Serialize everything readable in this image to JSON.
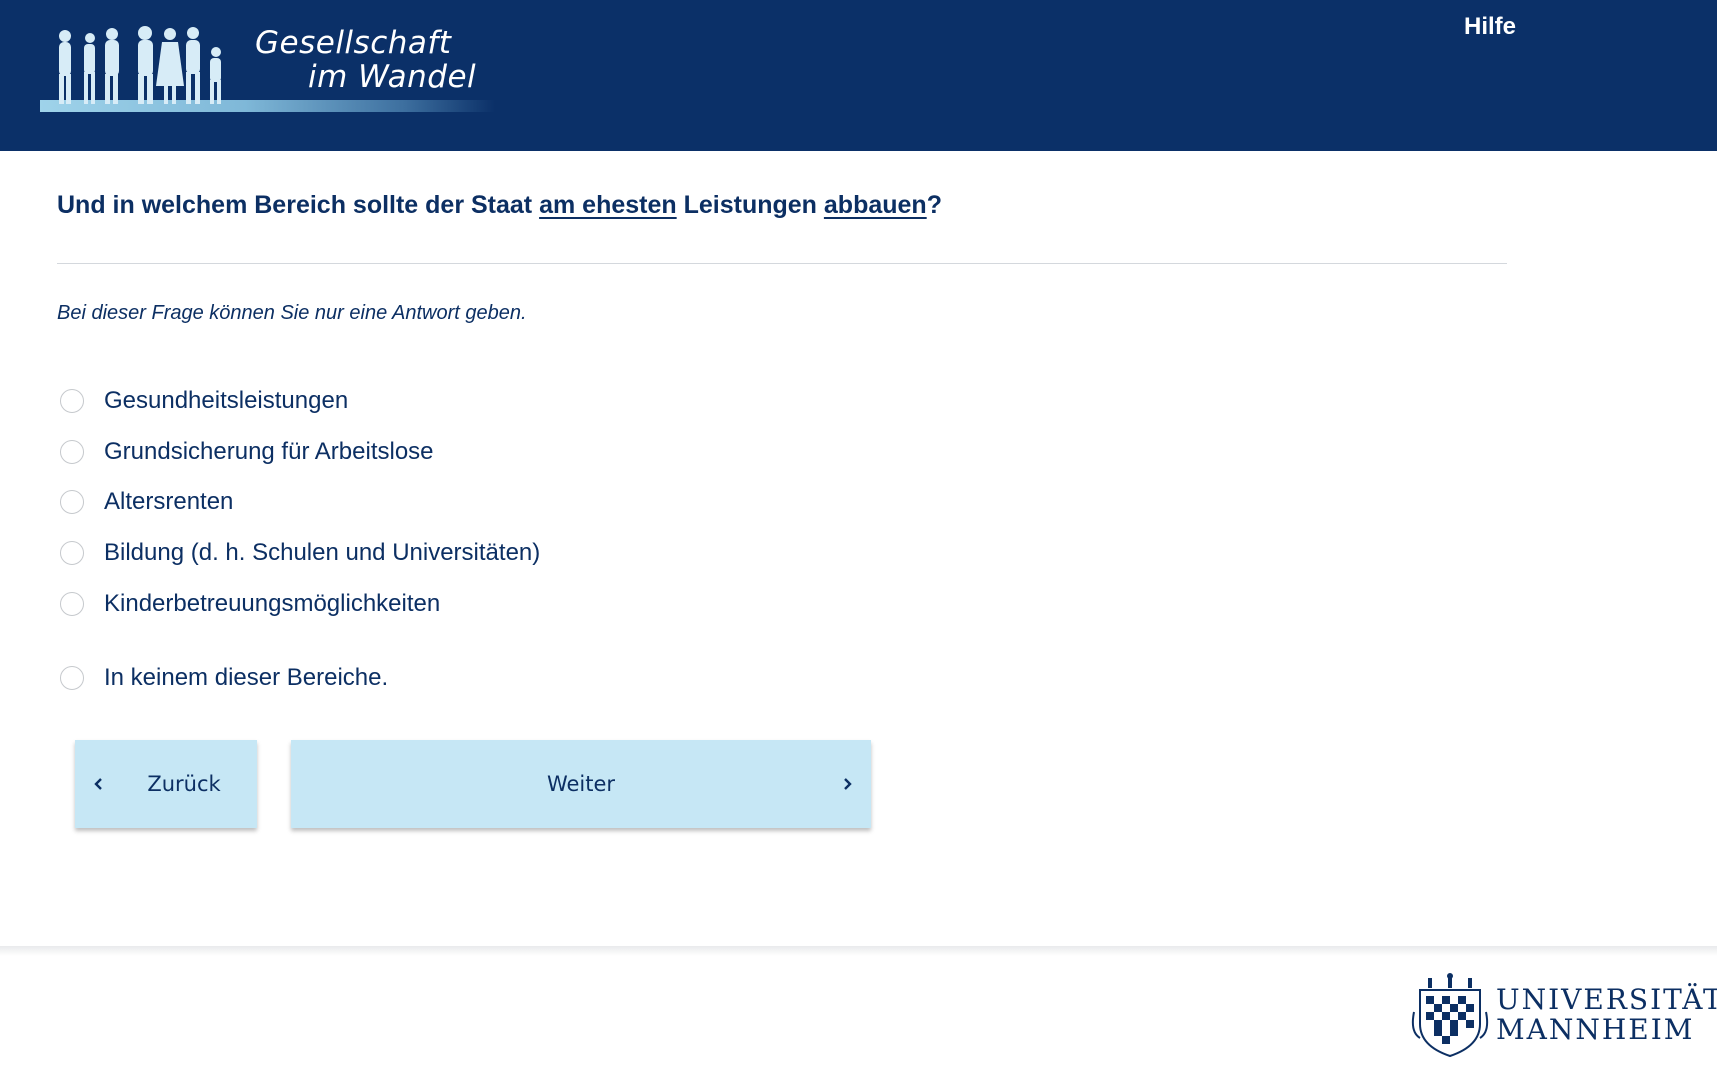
{
  "header": {
    "logo_line1": "Gesellschaft",
    "logo_line2": "im Wandel",
    "help_label": "Hilfe"
  },
  "question": {
    "part1": "Und in welchem Bereich sollte der Staat ",
    "emph1": "am ehesten",
    "part2": " Leistungen ",
    "emph2": "abbauen",
    "part3": "?"
  },
  "instruction": "Bei dieser Frage können Sie nur eine Antwort geben.",
  "options": [
    {
      "label": "Gesundheitsleistungen",
      "selected": false
    },
    {
      "label": "Grundsicherung für Arbeitslose",
      "selected": false
    },
    {
      "label": "Altersrenten",
      "selected": false
    },
    {
      "label": "Bildung (d. h. Schulen und Universitäten)",
      "selected": false
    },
    {
      "label": "Kinderbetreuungsmöglichkeiten",
      "selected": false
    },
    {
      "label": "In keinem dieser Bereiche.",
      "selected": false
    }
  ],
  "buttons": {
    "back_label": "Zurück",
    "next_label": "Weiter"
  },
  "footer": {
    "uni_line1": "UNIVERSITÄT",
    "uni_line2": "MANNHEIM"
  },
  "colors": {
    "header_bg": "#0b3068",
    "text": "#0c2f63",
    "button_bg": "#c6e7f5"
  }
}
